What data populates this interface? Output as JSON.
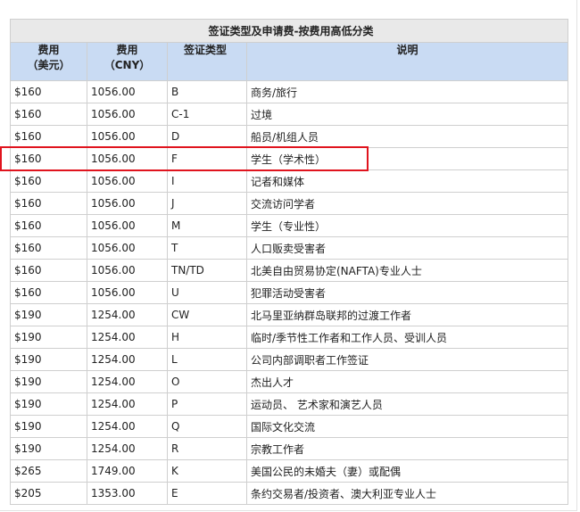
{
  "table": {
    "caption": "签证类型及申请费-按费用高低分类",
    "headers": {
      "usd_line1": "费用",
      "usd_line2": "（美元）",
      "cny_line1": "费用",
      "cny_line2": "（CNY）",
      "type": "签证类型",
      "notes": "说明"
    },
    "rows": [
      {
        "usd": "$160",
        "cny": "1056.00",
        "type": "B",
        "desc": "商务/旅行"
      },
      {
        "usd": "$160",
        "cny": "1056.00",
        "type": "C-1",
        "desc": "过境"
      },
      {
        "usd": "$160",
        "cny": "1056.00",
        "type": "D",
        "desc": "船员/机组人员"
      },
      {
        "usd": "$160",
        "cny": "1056.00",
        "type": "F",
        "desc": "学生（学术性）"
      },
      {
        "usd": "$160",
        "cny": "1056.00",
        "type": "I",
        "desc": "记者和媒体"
      },
      {
        "usd": "$160",
        "cny": "1056.00",
        "type": "J",
        "desc": "交流访问学者"
      },
      {
        "usd": "$160",
        "cny": "1056.00",
        "type": "M",
        "desc": "学生（专业性）"
      },
      {
        "usd": "$160",
        "cny": "1056.00",
        "type": "T",
        "desc": "人口贩卖受害者"
      },
      {
        "usd": "$160",
        "cny": "1056.00",
        "type": "TN/TD",
        "desc": "北美自由贸易协定(NAFTA)专业人士"
      },
      {
        "usd": "$160",
        "cny": "1056.00",
        "type": "U",
        "desc": "犯罪活动受害者"
      },
      {
        "usd": "$190",
        "cny": "1254.00",
        "type": "CW",
        "desc": "北马里亚纳群岛联邦的过渡工作者"
      },
      {
        "usd": "$190",
        "cny": "1254.00",
        "type": "H",
        "desc": "临时/季节性工作者和工作人员、受训人员"
      },
      {
        "usd": "$190",
        "cny": "1254.00",
        "type": "L",
        "desc": "公司内部调职者工作签证"
      },
      {
        "usd": "$190",
        "cny": "1254.00",
        "type": "O",
        "desc": "杰出人才"
      },
      {
        "usd": "$190",
        "cny": "1254.00",
        "type": "P",
        "desc": "运动员、 艺术家和演艺人员"
      },
      {
        "usd": "$190",
        "cny": "1254.00",
        "type": "Q",
        "desc": "国际文化交流"
      },
      {
        "usd": "$190",
        "cny": "1254.00",
        "type": "R",
        "desc": "宗教工作者"
      },
      {
        "usd": "$265",
        "cny": "1749.00",
        "type": "K",
        "desc": "美国公民的未婚夫（妻）或配偶"
      },
      {
        "usd": "$205",
        "cny": "1353.00",
        "type": "E",
        "desc": "条约交易者/投资者、澳大利亚专业人士"
      }
    ]
  },
  "colors": {
    "caption_bg": "#e9e9e9",
    "header_bg": "#c9dbf3",
    "border": "#cfcfcf",
    "highlight": "#e0141e"
  }
}
